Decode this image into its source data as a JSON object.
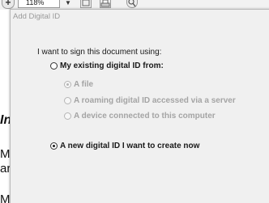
{
  "toolbar": {
    "zoom_value": "118%",
    "zoom_arrow": "▼",
    "icons": [
      "zoom-in-icon",
      "save-icon",
      "print-icon",
      "search-icon"
    ]
  },
  "document": {
    "heading_fragment": "In",
    "line1_fragment": "M",
    "line2_fragment": "ar",
    "line3_fragment": "M"
  },
  "dialog": {
    "title": "Add Digital ID",
    "prompt": "I want to sign this document using:",
    "options": [
      {
        "label": "My existing digital ID from:",
        "selected": false,
        "enabled": true
      },
      {
        "label": "A new digital ID I want to create now",
        "selected": true,
        "enabled": true
      }
    ],
    "sub_options": [
      {
        "label": "A file",
        "selected": true,
        "enabled": false
      },
      {
        "label": "A roaming digital ID accessed via a server",
        "selected": false,
        "enabled": false
      },
      {
        "label": "A device connected to this computer",
        "selected": false,
        "enabled": false
      }
    ]
  }
}
